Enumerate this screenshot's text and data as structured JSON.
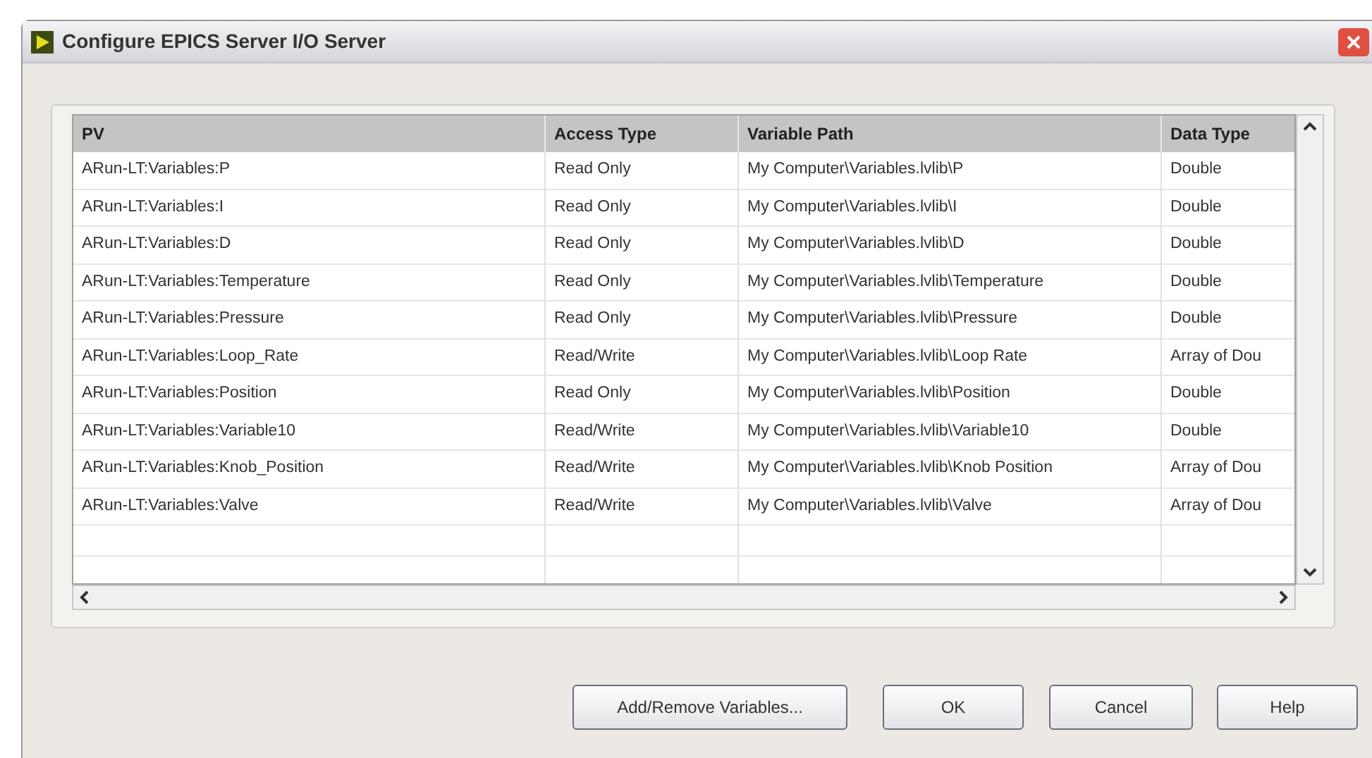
{
  "window": {
    "title": "Configure EPICS Server I/O Server"
  },
  "table": {
    "columns": [
      "PV",
      "Access Type",
      "Variable Path",
      "Data Type"
    ],
    "rows": [
      [
        "ARun-LT:Variables:P",
        "Read Only",
        "My Computer\\Variables.lvlib\\P",
        "Double"
      ],
      [
        "ARun-LT:Variables:I",
        "Read Only",
        "My Computer\\Variables.lvlib\\I",
        "Double"
      ],
      [
        "ARun-LT:Variables:D",
        "Read Only",
        "My Computer\\Variables.lvlib\\D",
        "Double"
      ],
      [
        "ARun-LT:Variables:Temperature",
        "Read Only",
        "My Computer\\Variables.lvlib\\Temperature",
        "Double"
      ],
      [
        "ARun-LT:Variables:Pressure",
        "Read Only",
        "My Computer\\Variables.lvlib\\Pressure",
        "Double"
      ],
      [
        "ARun-LT:Variables:Loop_Rate",
        "Read/Write",
        "My Computer\\Variables.lvlib\\Loop Rate",
        "Array of Dou"
      ],
      [
        "ARun-LT:Variables:Position",
        "Read Only",
        "My Computer\\Variables.lvlib\\Position",
        "Double"
      ],
      [
        "ARun-LT:Variables:Variable10",
        "Read/Write",
        "My Computer\\Variables.lvlib\\Variable10",
        "Double"
      ],
      [
        "ARun-LT:Variables:Knob_Position",
        "Read/Write",
        "My Computer\\Variables.lvlib\\Knob Position",
        "Array of Dou"
      ],
      [
        "ARun-LT:Variables:Valve",
        "Read/Write",
        "My Computer\\Variables.lvlib\\Valve",
        "Array of Dou"
      ]
    ]
  },
  "buttons": [
    "Add/Remove Variables...",
    "OK",
    "Cancel",
    "Help"
  ]
}
